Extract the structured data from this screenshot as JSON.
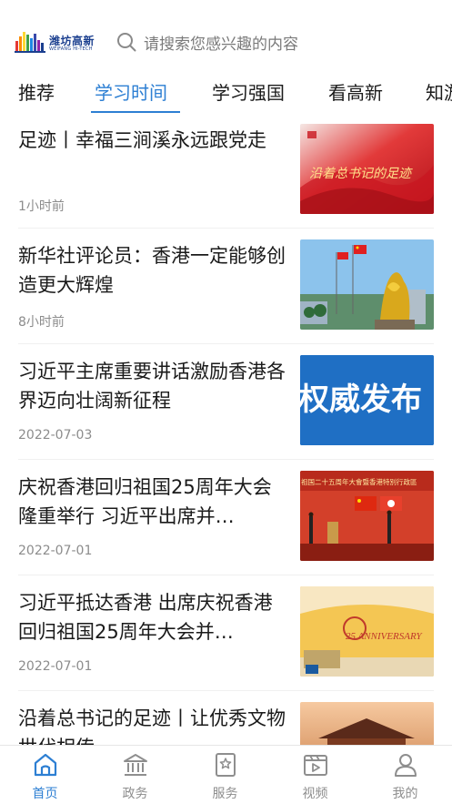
{
  "header": {
    "logo_cn": "潍坊高新",
    "logo_en": "WEIFANG HI-TECH",
    "search_placeholder": "请搜索您感兴趣的内容"
  },
  "tabs": [
    {
      "label": "推荐",
      "active": false
    },
    {
      "label": "学习时间",
      "active": true
    },
    {
      "label": "学习强国",
      "active": false
    },
    {
      "label": "看高新",
      "active": false
    },
    {
      "label": "知游",
      "active": false
    }
  ],
  "feed": [
    {
      "title": "足迹丨幸福三涧溪永远跟党走",
      "time": "1小时前",
      "thumb_text": "沿着总书记的足迹"
    },
    {
      "title": "新华社评论员：香港一定能够创造更大辉煌",
      "time": "8小时前",
      "thumb_text": ""
    },
    {
      "title": "习近平主席重要讲话激励香港各界迈向壮阔新征程",
      "time": "2022-07-03",
      "thumb_text": "权威发布"
    },
    {
      "title": "庆祝香港回归祖国25周年大会隆重举行 习近平出席并…",
      "time": "2022-07-01",
      "thumb_text": "祖国二十五周年大會暨香港特別行政區"
    },
    {
      "title": "习近平抵达香港 出席庆祝香港回归祖国25周年大会并…",
      "time": "2022-07-01",
      "thumb_text": "25 ANNIVERSARY"
    },
    {
      "title": "沿着总书记的足迹丨让优秀文物世代相传",
      "time": "",
      "thumb_text": ""
    }
  ],
  "bottom_nav": [
    {
      "label": "首页",
      "icon": "home-icon",
      "active": true
    },
    {
      "label": "政务",
      "icon": "government-icon",
      "active": false
    },
    {
      "label": "服务",
      "icon": "service-icon",
      "active": false
    },
    {
      "label": "视频",
      "icon": "video-icon",
      "active": false
    },
    {
      "label": "我的",
      "icon": "profile-icon",
      "active": false
    }
  ],
  "colors": {
    "accent": "#2d7fd3",
    "brand": "#1b3f8f",
    "text": "#1a1a1a",
    "muted": "#8c8c8c"
  }
}
